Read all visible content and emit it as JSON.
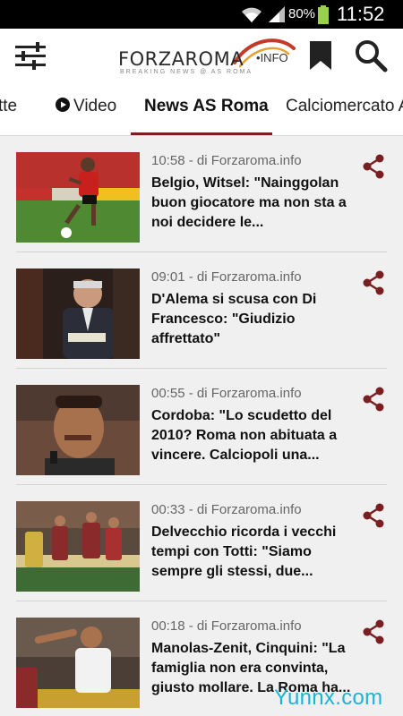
{
  "status_bar": {
    "battery": "80%",
    "time": "11:52"
  },
  "header": {
    "logo_main": "FORZAROMA",
    "logo_tld": "INFO",
    "logo_tagline": "BREAKING NEWS @ AS ROMA",
    "brand_color": "#7a1e22"
  },
  "tabs": [
    {
      "label": "tte"
    },
    {
      "label": "Video",
      "icon": "play-circle-icon"
    },
    {
      "label": "News AS Roma",
      "active": true
    },
    {
      "label": "Calciomercato A"
    }
  ],
  "articles": [
    {
      "meta": "10:58 - di Forzaroma.info",
      "headline": "Belgio, Witsel: \"Nainggolan buon giocatore ma non sta a noi decidere le..."
    },
    {
      "meta": "09:01 - di Forzaroma.info",
      "headline": "D'Alema si scusa con Di Francesco: \"Giudizio affrettato\""
    },
    {
      "meta": "00:55 - di Forzaroma.info",
      "headline": "Cordoba: \"Lo scudetto del 2010? Roma non abituata a vincere. Calciopoli una..."
    },
    {
      "meta": "00:33 - di Forzaroma.info",
      "headline": "Delvecchio ricorda i vecchi tempi con Totti: \"Siamo sempre gli stessi, due..."
    },
    {
      "meta": "00:18 - di Forzaroma.info",
      "headline": "Manolas-Zenit, Cinquini: \"La famiglia non era convinta, giusto mollare. La Roma ha..."
    }
  ],
  "watermark": "Yunnx.com"
}
